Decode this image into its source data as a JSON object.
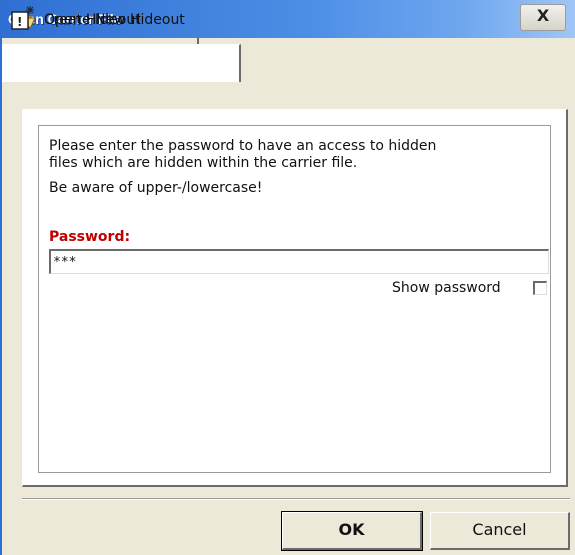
{
  "window": {
    "title": "Open Carrier File",
    "close_label": "X"
  },
  "tabs": [
    {
      "label": "Open Hideout",
      "icon": "open-folder-icon",
      "selected": true
    },
    {
      "label": "Create New Hideout",
      "icon": "new-document-icon",
      "selected": false
    }
  ],
  "panel": {
    "instructions_line1": "Please enter the password to have an access to hidden",
    "instructions_line2": "files which are hidden within the carrier file.",
    "case_warning": "Be aware of upper-/lowercase!",
    "password_label": "Password:",
    "password_value": "***",
    "show_password_label": "Show password",
    "show_password_checked": false
  },
  "buttons": {
    "ok_label": "OK",
    "cancel_label": "Cancel"
  },
  "colors": {
    "titlebar_start": "#2f6fd3",
    "titlebar_end": "#9fc6f5",
    "password_label": "#c00000",
    "dialog_background": "#ece9d8"
  }
}
